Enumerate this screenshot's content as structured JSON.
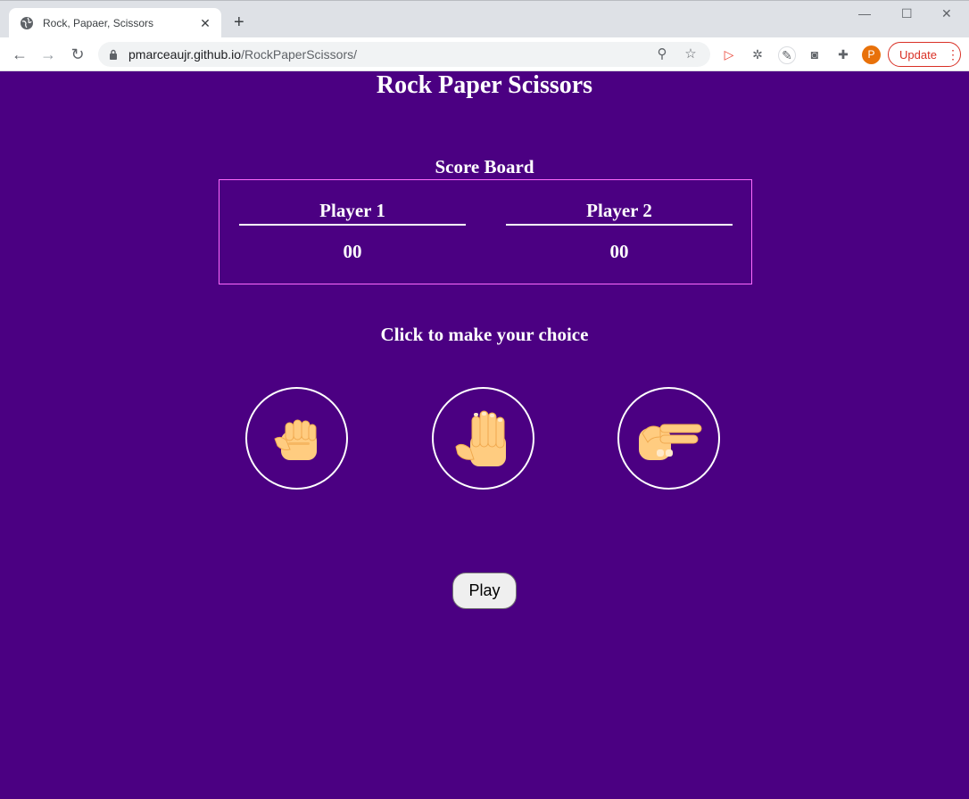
{
  "browser": {
    "tab_title": "Rock, Papaer, Scissors",
    "url_host": "pmarceaujr.github.io",
    "url_path": "/RockPaperScissors/",
    "profile_initial": "P",
    "update_label": "Update"
  },
  "page": {
    "title": "Rock Paper Scissors",
    "scoreboard_title": "Score Board",
    "players": [
      {
        "name": "Player 1",
        "score": "00"
      },
      {
        "name": "Player 2",
        "score": "00"
      }
    ],
    "choice_prompt": "Click to make your choice",
    "choices": [
      {
        "icon": "rock-hand-icon"
      },
      {
        "icon": "paper-hand-icon"
      },
      {
        "icon": "scissors-hand-icon"
      }
    ],
    "play_label": "Play"
  },
  "colors": {
    "background": "#4b0082",
    "scoreboard_border": "#ff6bff",
    "skin": "#ffcc80"
  }
}
